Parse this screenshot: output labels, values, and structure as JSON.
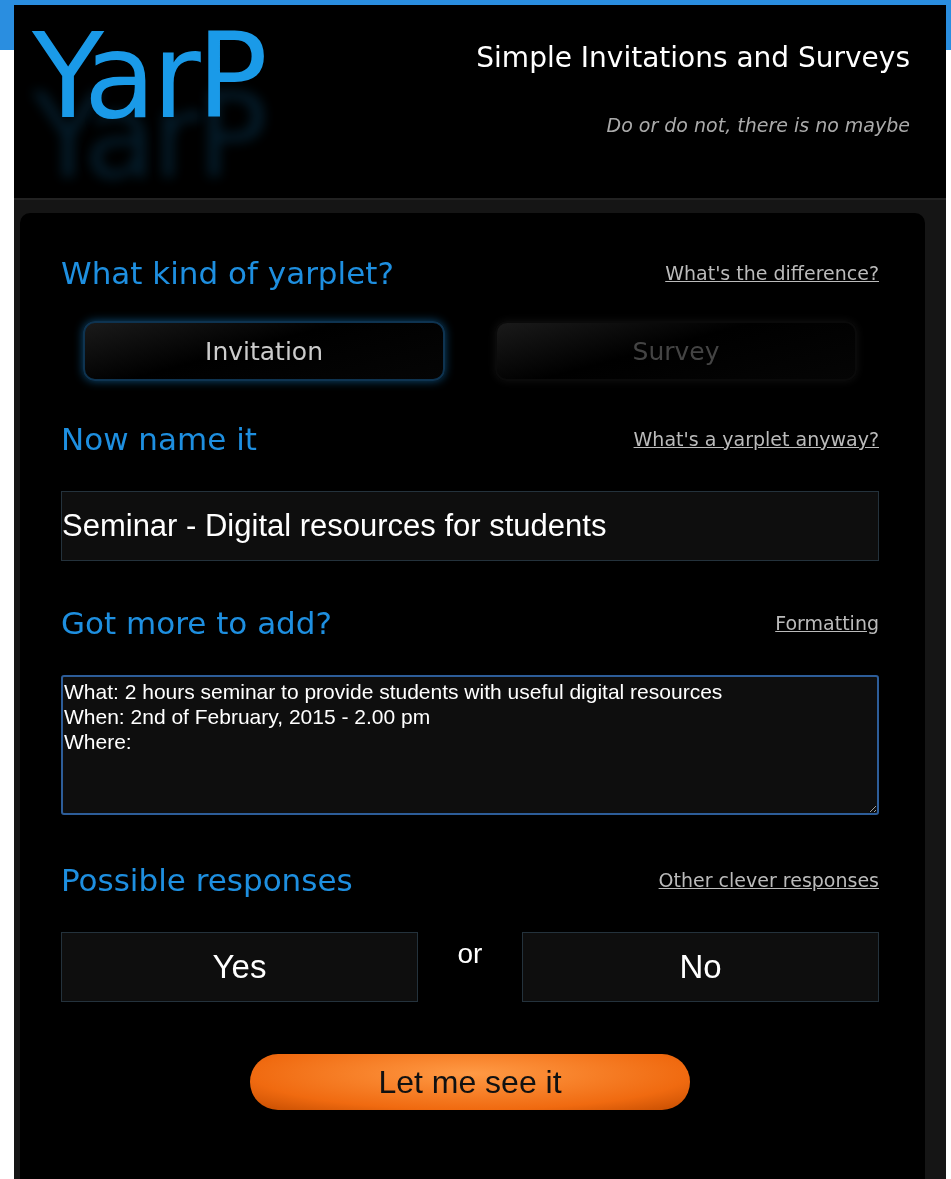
{
  "header": {
    "logo": "YarP",
    "title": "Simple Invitations and Surveys",
    "tagline": "Do or do not, there is no maybe"
  },
  "sections": [
    {
      "heading": "What kind of yarplet?",
      "link": "What's the difference?"
    },
    {
      "heading": "Now name it",
      "link": "What's a yarplet anyway?"
    },
    {
      "heading": "Got more to add?",
      "link": "Formatting"
    },
    {
      "heading": "Possible responses",
      "link": "Other clever responses"
    }
  ],
  "types": [
    {
      "label": "Invitation",
      "selected": true
    },
    {
      "label": "Survey",
      "selected": false
    }
  ],
  "name_field": {
    "value": "Seminar - Digital resources for students"
  },
  "details_field": {
    "value": "What: 2 hours seminar to provide students with useful digital resources\nWhen: 2nd of February, 2015 - 2.00 pm\nWhere: "
  },
  "responses": {
    "options": [
      "Yes",
      "No"
    ],
    "separator": "or"
  },
  "submit": "Let me see it"
}
